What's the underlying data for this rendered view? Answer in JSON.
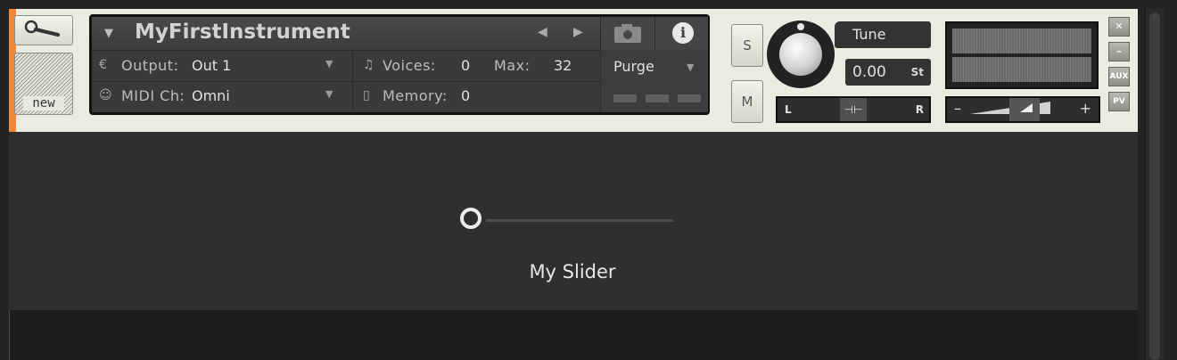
{
  "instrument": {
    "name": "MyFirstInstrument",
    "new_label": "new"
  },
  "routing": {
    "output_label": "Output:",
    "output_value": "Out 1",
    "midi_label": "MIDI Ch:",
    "midi_value": "Omni"
  },
  "voices": {
    "voices_label": "Voices:",
    "voices_value": "0",
    "max_label": "Max:",
    "max_value": "32"
  },
  "memory": {
    "label": "Memory:",
    "value": "0"
  },
  "purge": {
    "label": "Purge"
  },
  "solo_mute": {
    "solo": "S",
    "mute": "M"
  },
  "tune": {
    "label": "Tune",
    "value": "0.00",
    "unit": "St"
  },
  "pan": {
    "left": "L",
    "right": "R"
  },
  "volume": {
    "minus": "–",
    "plus": "+"
  },
  "side_buttons": {
    "close": "✕",
    "minimize": "–",
    "aux": "AUX",
    "pv": "PV"
  },
  "ui": {
    "slider_label": "My Slider",
    "slider_value": 0
  },
  "colors": {
    "accent": "#f08a3b",
    "header_bg": "#ecebe1",
    "panel_bg": "#3a3a3a",
    "body_bg": "#2f2f2f"
  },
  "icons": {
    "wrench": "wrench-icon",
    "camera": "camera-icon",
    "info": "info-icon"
  }
}
